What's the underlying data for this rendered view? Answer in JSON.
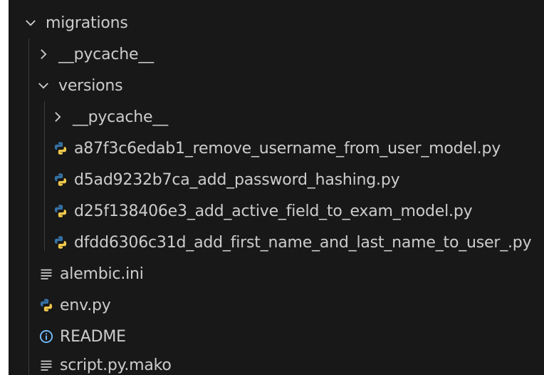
{
  "explorer": {
    "tree": {
      "migrations": "migrations",
      "migrations_pycache": "__pycache__",
      "versions": "versions",
      "versions_pycache": "__pycache__",
      "files_versions": [
        "a87f3c6edab1_remove_username_from_user_model.py",
        "d5ad9232b7ca_add_password_hashing.py",
        "d25f138406e3_add_active_field_to_exam_model.py",
        "dfdd6306c31d_add_first_name_and_last_name_to_user_.py"
      ],
      "alembic_ini": "alembic.ini",
      "env_py": "env.py",
      "readme": "README",
      "script_mako": "script.py.mako"
    },
    "icons": {
      "folder_open": "chevron-down-icon",
      "folder_closed": "chevron-right-icon",
      "python": "python-icon",
      "settings_file": "lines-icon",
      "info": "info-icon"
    },
    "colors": {
      "background": "#181818",
      "text": "#cccccc",
      "python_blue": "#3572A5",
      "python_yellow": "#F0C94C",
      "info_blue": "#75BEFF"
    }
  }
}
